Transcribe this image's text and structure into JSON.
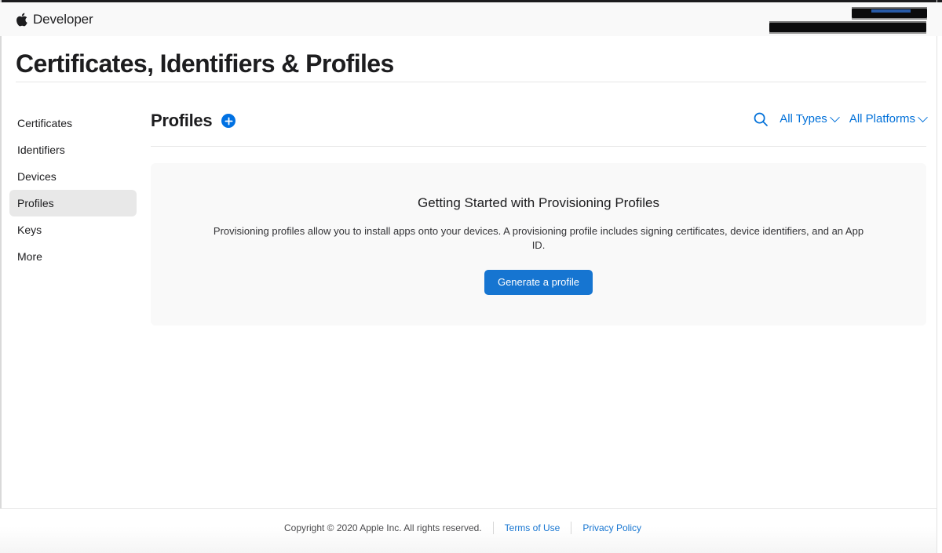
{
  "window": {
    "accent_color": "#0071e3",
    "link_color": "#1675d1"
  },
  "globalnav": {
    "apple_logo_icon": "apple-logo-icon",
    "brand_name": "Developer",
    "account_redacted_line_1": "",
    "account_redacted_line_2": ""
  },
  "page": {
    "title": "Certificates, Identifiers & Profiles"
  },
  "sidebar": {
    "items": [
      {
        "label": "Certificates",
        "selected": false
      },
      {
        "label": "Identifiers",
        "selected": false
      },
      {
        "label": "Devices",
        "selected": false
      },
      {
        "label": "Profiles",
        "selected": true
      },
      {
        "label": "Keys",
        "selected": false
      },
      {
        "label": "More",
        "selected": false
      }
    ]
  },
  "main": {
    "section_title": "Profiles",
    "add_button_label": "+",
    "add_button_icon": "plus-circle-icon",
    "search_icon": "search-icon",
    "filters": [
      {
        "label": "All Types",
        "icon": "chevron-down-icon"
      },
      {
        "label": "All Platforms",
        "icon": "chevron-down-icon"
      }
    ],
    "card": {
      "title": "Getting Started with Provisioning Profiles",
      "description": "Provisioning profiles allow you to install apps onto your devices. A provisioning profile includes signing certificates, device identifiers, and an App ID.",
      "cta_label": "Generate a profile"
    }
  },
  "footer": {
    "copyright": "Copyright © 2020 Apple Inc. All rights reserved.",
    "links": [
      {
        "label": "Terms of Use"
      },
      {
        "label": "Privacy Policy"
      }
    ]
  }
}
